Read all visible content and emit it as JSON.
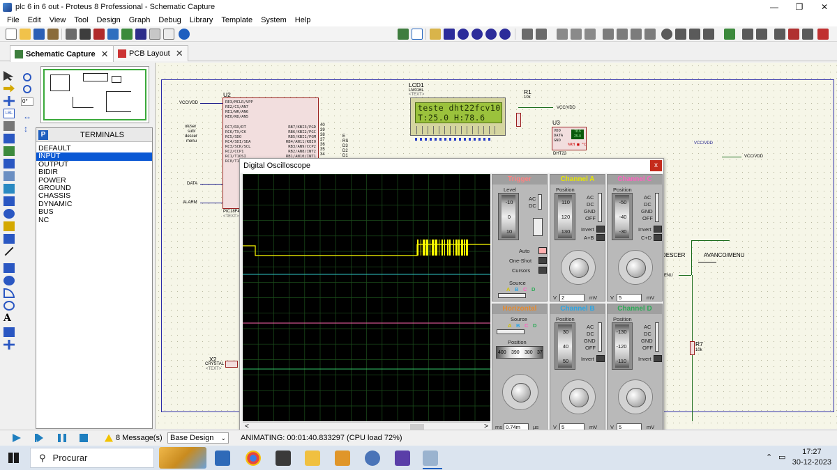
{
  "window": {
    "title": "plc 6 in 6 out - Proteus 8 Professional - Schematic Capture",
    "minimize": "—",
    "maximize": "❐",
    "close": "✕"
  },
  "menu": [
    "File",
    "Edit",
    "View",
    "Tool",
    "Design",
    "Graph",
    "Debug",
    "Library",
    "Template",
    "System",
    "Help"
  ],
  "tabs": [
    {
      "label": "Schematic Capture",
      "close": "✕"
    },
    {
      "label": "PCB Layout",
      "close": "✕"
    }
  ],
  "left_tools": {
    "rotation": "0°"
  },
  "device_panel": {
    "icon_letter": "P",
    "title": "TERMINALS",
    "items": [
      "DEFAULT",
      "INPUT",
      "OUTPUT",
      "BIDIR",
      "POWER",
      "GROUND",
      "CHASSIS",
      "DYNAMIC",
      "BUS",
      "NC"
    ],
    "selected": "INPUT"
  },
  "schematic": {
    "u2_ref": "U2",
    "u2_part": "PIC18F4…",
    "text_placeholder": "<TEXT>",
    "left_labels": [
      "VCC/VDD",
      "ok/ser",
      "sub/",
      "descer",
      "menu",
      "DATA",
      "ALARM"
    ],
    "left_pins": [
      "RE3/MCLR/VPP",
      "RE2/CS/AN7",
      "RE1/WR/AN6",
      "RE0/RD/AN5",
      "RC7/RX/DT",
      "RC6/TX/CK",
      "RC5/SDO",
      "RC4/SDI/SDA",
      "RC3/SCK/SCL",
      "RC2/CCP1",
      "RC1/T1OSI",
      "RC0/T1OSO"
    ],
    "right_pins": [
      "RB7/KBI3/PGD",
      "RB6/KBI2/PGC",
      "RB5/KBI1/PGM",
      "RB4/AN11/KBI0",
      "RB3/AN9/CCP2",
      "RB2/AN8/INT2",
      "RB1/AN10/INT1"
    ],
    "pin_numbers_right": [
      "40",
      "39",
      "38",
      "37",
      "36",
      "35",
      "34"
    ],
    "net_labels_right": [
      "E",
      "RS",
      "D3",
      "D2",
      "D1"
    ],
    "lcd_ref": "LCD1",
    "lcd_part": "LM016L",
    "lcd_line1": "teste dht22fcv10",
    "lcd_line2": "T:25.0  H:78.6",
    "r1_ref": "R1",
    "r1_value": "10k",
    "vcc_label": "VCC/VDD",
    "u3_ref": "U3",
    "u3_part": "DHT22",
    "u3_pins": [
      "VDD",
      "DATA",
      "GND"
    ],
    "dht_display_1": "78.6",
    "dht_display_2": "25.0",
    "dht_unit": "%RH ■ °C",
    "vccvdd_right": "VCC/VDD",
    "x2_ref": "X2",
    "x2_part": "CRYSTAL",
    "r7_ref": "R7",
    "r7_value": "10k",
    "button_label_1": "DESCER",
    "button_label_2": "AVANCO/MENU",
    "menu_net": "MENU"
  },
  "oscilloscope": {
    "title": "Digital Oscilloscope",
    "close": "x",
    "trigger": {
      "title": "Trigger",
      "level_label": "Level",
      "level_scale": [
        "-10",
        "0",
        "10"
      ],
      "coupling": [
        "AC",
        "DC"
      ],
      "modes": [
        "Auto",
        "One-Shot",
        "Cursors"
      ],
      "source_label": "Source",
      "sources": [
        "A",
        "B",
        "C",
        "D"
      ]
    },
    "horizontal": {
      "title": "Horizontal",
      "source_label": "Source",
      "sources": [
        "A",
        "B",
        "C",
        "D"
      ],
      "position_label": "Position",
      "position_scale": [
        "400",
        "390",
        "380",
        "37"
      ],
      "knob_scale": [
        "0.5",
        "0.2",
        "0.1",
        "50",
        "20",
        "10",
        "5",
        "2",
        "1"
      ],
      "time_value": "0.74m",
      "unit_left": "ms",
      "unit_right": "µs"
    },
    "channels": [
      {
        "title": "Channel A",
        "title_color": "#e6e600",
        "position_label": "Position",
        "scale": [
          "110",
          "120",
          "130"
        ],
        "modes": [
          "AC",
          "DC",
          "GND",
          "OFF"
        ],
        "invert": "Invert",
        "combine": "A+B",
        "volts": "2",
        "unit_left": "V",
        "unit_right": "mV"
      },
      {
        "title": "Channel C",
        "title_color": "#ff60c0",
        "position_label": "Position",
        "scale": [
          "-50",
          "-40",
          "-30"
        ],
        "modes": [
          "AC",
          "DC",
          "GND",
          "OFF"
        ],
        "invert": "Invert",
        "combine": "C+D",
        "volts": "5",
        "unit_left": "V",
        "unit_right": "mV"
      },
      {
        "title": "Channel B",
        "title_color": "#2aa6e6",
        "position_label": "Position",
        "scale": [
          "30",
          "40",
          "50"
        ],
        "modes": [
          "AC",
          "DC",
          "GND",
          "OFF"
        ],
        "invert": "Invert",
        "volts": "5",
        "unit_left": "V",
        "unit_right": "mV"
      },
      {
        "title": "Channel D",
        "title_color": "#2aaa55",
        "position_label": "Position",
        "scale": [
          "-130",
          "-120",
          "-110"
        ],
        "modes": [
          "AC",
          "DC",
          "GND",
          "OFF"
        ],
        "invert": "Invert",
        "volts": "5",
        "unit_left": "V",
        "unit_right": "mV"
      }
    ],
    "knob_scale": [
      "0.5",
      "0.2",
      "0.1",
      "50",
      "20",
      "10",
      "5",
      "2",
      "1"
    ]
  },
  "status": {
    "messages": "8 Message(s)",
    "design": "Base Design",
    "animating": "ANIMATING: 00:01:40.833297 (CPU load 72%)"
  },
  "taskbar": {
    "search": "Procurar",
    "time": "17:27",
    "date": "30-12-2023"
  },
  "colors": {
    "trace_a": "#ffff00",
    "trace_b": "#2fc6c6",
    "trace_c": "#ff66b0",
    "trace_d": "#33c96a",
    "grid": "#1c4f1c",
    "lcd_bg": "#9bc23c"
  }
}
